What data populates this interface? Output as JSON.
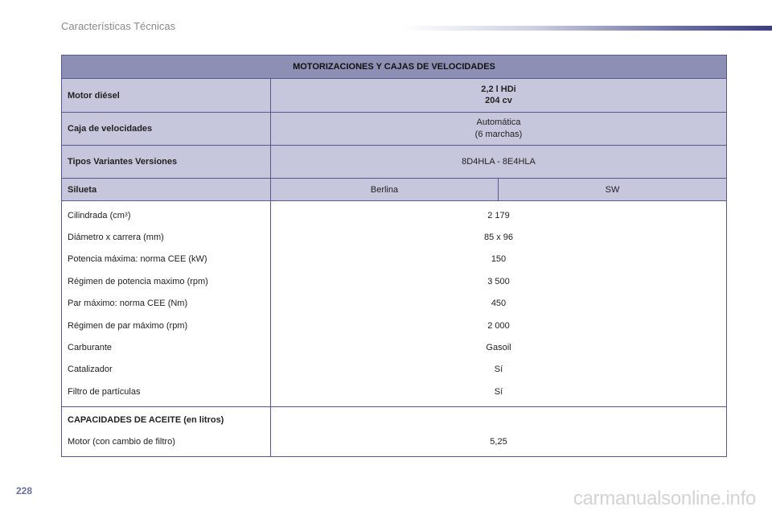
{
  "header": {
    "section_title": "Características Técnicas",
    "page_number": "228"
  },
  "table": {
    "title": "MOTORIZACIONES Y CAJAS DE VELOCIDADES",
    "engine": {
      "label": "Motor diésel",
      "value_line1": "2,2 l HDi",
      "value_line2": "204 cv"
    },
    "gearbox": {
      "label": "Caja de velocidades",
      "value_line1": "Automática",
      "value_line2": "(6 marchas)"
    },
    "variants": {
      "label": "Tipos Variantes Versiones",
      "value": "8D4HLA - 8E4HLA"
    },
    "silhouette": {
      "label": "Silueta",
      "value_left": "Berlina",
      "value_right": "SW"
    },
    "specs": [
      {
        "label": "Cilindrada (cm",
        "label_sup": "3",
        "label_end": ")",
        "value": "2 179"
      },
      {
        "label": "Diámetro x carrera (mm)",
        "value": "85 x 96"
      },
      {
        "label": "Potencia máxima: norma CEE (kW)",
        "value": "150"
      },
      {
        "label": "Régimen de potencia maximo (rpm)",
        "value": "3 500"
      },
      {
        "label": "Par máximo: norma CEE (Nm)",
        "value": "450"
      },
      {
        "label": "Régimen de par máximo (rpm)",
        "value": "2 000"
      },
      {
        "label": "Carburante",
        "value": "Gasoil"
      },
      {
        "label": "Catalizador",
        "value": "Sí"
      },
      {
        "label": "Filtro de partículas",
        "value": "Sí"
      }
    ],
    "oil": {
      "heading": "CAPACIDADES DE ACEITE (en litros)",
      "engine_label": "Motor (con cambio de filtro)",
      "engine_value": "5,25"
    }
  },
  "watermark": "carmanualsonline.info",
  "colors": {
    "title_bg": "#8d8fb4",
    "shaded_bg": "#c6c7dc",
    "border": "#55598a",
    "page_number": "#6b6fa0"
  }
}
